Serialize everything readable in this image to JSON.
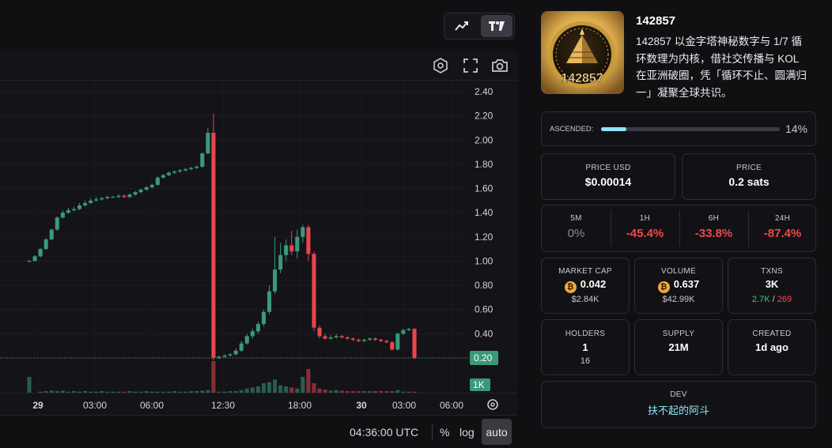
{
  "chart": {
    "style_buttons": [
      {
        "icon": "line-trend-icon"
      },
      {
        "icon": "tradingview-icon"
      }
    ],
    "toolbar_icons": [
      "indicator-hexagon-icon",
      "fullscreen-icon",
      "camera-icon"
    ],
    "price_ticks": [
      "2.40",
      "2.20",
      "2.00",
      "1.80",
      "1.60",
      "1.40",
      "1.20",
      "1.00",
      "0.80",
      "0.60",
      "0.40",
      "0.20"
    ],
    "time_ticks": [
      "29",
      "03:00",
      "06:00",
      "12:30",
      "18:00",
      "30",
      "03:00",
      "06:00"
    ],
    "last_price_label": "0.20",
    "volume_label": "1K",
    "clock": "04:36:00 UTC",
    "scale_percent": "%",
    "scale_log": "log",
    "scale_auto": "auto",
    "up_color": "#3a9a78",
    "down_color": "#e8454f"
  },
  "token": {
    "name": "142857",
    "image_text": "142857",
    "description": "142857 以金字塔神秘数字与 1/7 循环数理为内核，借社交传播与 KOL 在亚洲破圈，凭「循环不止、圆满归一」凝聚全球共识。"
  },
  "ascended": {
    "label": "ASCENDED:",
    "percent_text": "14%",
    "fraction": 0.14
  },
  "price_usd": {
    "label": "PRICE USD",
    "value": "$0.00014"
  },
  "price": {
    "label": "PRICE",
    "value": "0.2 sats"
  },
  "changes": [
    {
      "label": "5M",
      "value": "0%",
      "tone": "neutral"
    },
    {
      "label": "1H",
      "value": "-45.4%",
      "tone": "down"
    },
    {
      "label": "6H",
      "value": "-33.8%",
      "tone": "down"
    },
    {
      "label": "24H",
      "value": "-87.4%",
      "tone": "down"
    }
  ],
  "market_cap": {
    "label": "MARKET CAP",
    "value": "0.042",
    "sub": "$2.84K"
  },
  "volume": {
    "label": "VOLUME",
    "value": "0.637",
    "sub": "$42.99K"
  },
  "txns": {
    "label": "TXNS",
    "value": "3K",
    "buys": "2.7K",
    "sep": "/",
    "sells": "269"
  },
  "holders": {
    "label": "HOLDERS",
    "value": "1",
    "sub": "16"
  },
  "supply": {
    "label": "SUPPLY",
    "value": "21M"
  },
  "created": {
    "label": "CREATED",
    "value": "1d ago"
  },
  "dev": {
    "label": "DEV",
    "value": "扶不起的阿斗"
  },
  "chart_data": {
    "type": "candlestick",
    "ylim": [
      0.1,
      2.45
    ],
    "price_axis": [
      2.4,
      2.2,
      2.0,
      1.8,
      1.6,
      1.4,
      1.2,
      1.0,
      0.8,
      0.6,
      0.4,
      0.2
    ],
    "candles": [
      {
        "o": 1.0,
        "c": 1.0,
        "h": 1.01,
        "l": 0.99
      },
      {
        "o": 1.0,
        "c": 1.04,
        "h": 1.05,
        "l": 1.0
      },
      {
        "o": 1.04,
        "c": 1.1,
        "h": 1.11,
        "l": 1.03
      },
      {
        "o": 1.1,
        "c": 1.18,
        "h": 1.19,
        "l": 1.09
      },
      {
        "o": 1.18,
        "c": 1.26,
        "h": 1.27,
        "l": 1.17
      },
      {
        "o": 1.26,
        "c": 1.36,
        "h": 1.37,
        "l": 1.25
      },
      {
        "o": 1.36,
        "c": 1.4,
        "h": 1.42,
        "l": 1.35
      },
      {
        "o": 1.4,
        "c": 1.42,
        "h": 1.44,
        "l": 1.39
      },
      {
        "o": 1.42,
        "c": 1.43,
        "h": 1.45,
        "l": 1.41
      },
      {
        "o": 1.43,
        "c": 1.46,
        "h": 1.48,
        "l": 1.42
      },
      {
        "o": 1.46,
        "c": 1.48,
        "h": 1.5,
        "l": 1.45
      },
      {
        "o": 1.48,
        "c": 1.5,
        "h": 1.52,
        "l": 1.47
      },
      {
        "o": 1.5,
        "c": 1.51,
        "h": 1.53,
        "l": 1.49
      },
      {
        "o": 1.51,
        "c": 1.52,
        "h": 1.53,
        "l": 1.5
      },
      {
        "o": 1.52,
        "c": 1.53,
        "h": 1.54,
        "l": 1.51
      },
      {
        "o": 1.53,
        "c": 1.53,
        "h": 1.54,
        "l": 1.52
      },
      {
        "o": 1.53,
        "c": 1.54,
        "h": 1.55,
        "l": 1.52
      },
      {
        "o": 1.54,
        "c": 1.53,
        "h": 1.55,
        "l": 1.52
      },
      {
        "o": 1.53,
        "c": 1.55,
        "h": 1.56,
        "l": 1.52
      },
      {
        "o": 1.55,
        "c": 1.57,
        "h": 1.58,
        "l": 1.54
      },
      {
        "o": 1.57,
        "c": 1.59,
        "h": 1.6,
        "l": 1.56
      },
      {
        "o": 1.59,
        "c": 1.61,
        "h": 1.62,
        "l": 1.58
      },
      {
        "o": 1.61,
        "c": 1.63,
        "h": 1.64,
        "l": 1.6
      },
      {
        "o": 1.63,
        "c": 1.69,
        "h": 1.7,
        "l": 1.62
      },
      {
        "o": 1.69,
        "c": 1.71,
        "h": 1.72,
        "l": 1.68
      },
      {
        "o": 1.71,
        "c": 1.73,
        "h": 1.74,
        "l": 1.7
      },
      {
        "o": 1.73,
        "c": 1.74,
        "h": 1.75,
        "l": 1.72
      },
      {
        "o": 1.74,
        "c": 1.75,
        "h": 1.76,
        "l": 1.73
      },
      {
        "o": 1.75,
        "c": 1.76,
        "h": 1.77,
        "l": 1.74
      },
      {
        "o": 1.76,
        "c": 1.77,
        "h": 1.78,
        "l": 1.75
      },
      {
        "o": 1.77,
        "c": 1.78,
        "h": 1.79,
        "l": 1.76
      },
      {
        "o": 1.78,
        "c": 1.89,
        "h": 1.9,
        "l": 1.77
      },
      {
        "o": 1.89,
        "c": 2.06,
        "h": 2.1,
        "l": 1.88
      },
      {
        "o": 2.06,
        "c": 0.2,
        "h": 2.22,
        "l": 0.18
      },
      {
        "o": 0.2,
        "c": 0.21,
        "h": 0.22,
        "l": 0.19
      },
      {
        "o": 0.21,
        "c": 0.22,
        "h": 0.23,
        "l": 0.2
      },
      {
        "o": 0.22,
        "c": 0.23,
        "h": 0.24,
        "l": 0.21
      },
      {
        "o": 0.23,
        "c": 0.26,
        "h": 0.28,
        "l": 0.22
      },
      {
        "o": 0.26,
        "c": 0.32,
        "h": 0.34,
        "l": 0.25
      },
      {
        "o": 0.32,
        "c": 0.38,
        "h": 0.4,
        "l": 0.31
      },
      {
        "o": 0.38,
        "c": 0.42,
        "h": 0.44,
        "l": 0.36
      },
      {
        "o": 0.42,
        "c": 0.48,
        "h": 0.5,
        "l": 0.4
      },
      {
        "o": 0.48,
        "c": 0.58,
        "h": 0.6,
        "l": 0.46
      },
      {
        "o": 0.58,
        "c": 0.75,
        "h": 0.8,
        "l": 0.56
      },
      {
        "o": 0.75,
        "c": 0.93,
        "h": 1.2,
        "l": 0.73
      },
      {
        "o": 0.93,
        "c": 1.05,
        "h": 1.15,
        "l": 0.9
      },
      {
        "o": 1.05,
        "c": 1.13,
        "h": 1.18,
        "l": 1.0
      },
      {
        "o": 1.13,
        "c": 1.08,
        "h": 1.25,
        "l": 1.05
      },
      {
        "o": 1.08,
        "c": 1.2,
        "h": 1.26,
        "l": 1.02
      },
      {
        "o": 1.2,
        "c": 1.28,
        "h": 1.3,
        "l": 1.15
      },
      {
        "o": 1.28,
        "c": 1.06,
        "h": 1.3,
        "l": 1.0
      },
      {
        "o": 1.06,
        "c": 0.45,
        "h": 1.08,
        "l": 0.42
      },
      {
        "o": 0.45,
        "c": 0.38,
        "h": 0.47,
        "l": 0.36
      },
      {
        "o": 0.38,
        "c": 0.36,
        "h": 0.4,
        "l": 0.35
      },
      {
        "o": 0.36,
        "c": 0.37,
        "h": 0.39,
        "l": 0.35
      },
      {
        "o": 0.37,
        "c": 0.38,
        "h": 0.4,
        "l": 0.36
      },
      {
        "o": 0.38,
        "c": 0.37,
        "h": 0.39,
        "l": 0.36
      },
      {
        "o": 0.37,
        "c": 0.36,
        "h": 0.38,
        "l": 0.35
      },
      {
        "o": 0.36,
        "c": 0.35,
        "h": 0.37,
        "l": 0.34
      },
      {
        "o": 0.35,
        "c": 0.34,
        "h": 0.36,
        "l": 0.33
      },
      {
        "o": 0.34,
        "c": 0.35,
        "h": 0.36,
        "l": 0.33
      },
      {
        "o": 0.35,
        "c": 0.36,
        "h": 0.37,
        "l": 0.34
      },
      {
        "o": 0.36,
        "c": 0.35,
        "h": 0.37,
        "l": 0.34
      },
      {
        "o": 0.35,
        "c": 0.34,
        "h": 0.36,
        "l": 0.33
      },
      {
        "o": 0.34,
        "c": 0.33,
        "h": 0.35,
        "l": 0.32
      },
      {
        "o": 0.33,
        "c": 0.27,
        "h": 0.34,
        "l": 0.26
      },
      {
        "o": 0.27,
        "c": 0.4,
        "h": 0.41,
        "l": 0.26
      },
      {
        "o": 0.4,
        "c": 0.43,
        "h": 0.44,
        "l": 0.39
      },
      {
        "o": 0.43,
        "c": 0.44,
        "h": 0.45,
        "l": 0.42
      },
      {
        "o": 0.44,
        "c": 0.2,
        "h": 0.45,
        "l": 0.19
      }
    ],
    "volume": [
      30,
      0,
      2,
      3,
      4,
      3,
      4,
      2,
      3,
      2,
      3,
      2,
      2,
      3,
      2,
      2,
      2,
      2,
      3,
      2,
      2,
      3,
      2,
      2,
      2,
      2,
      3,
      2,
      2,
      3,
      3,
      4,
      5,
      60,
      2,
      2,
      3,
      3,
      5,
      8,
      10,
      12,
      18,
      20,
      25,
      14,
      12,
      10,
      8,
      30,
      45,
      18,
      8,
      6,
      4,
      5,
      4,
      3,
      3,
      3,
      3,
      3,
      3,
      3,
      3,
      3,
      5,
      2,
      2,
      2,
      8
    ]
  }
}
